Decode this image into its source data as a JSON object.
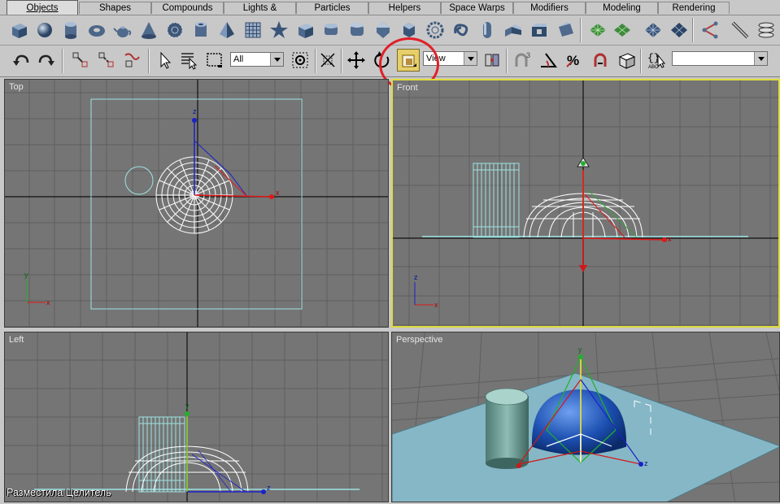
{
  "tabs": [
    {
      "label": "Objects",
      "active": true
    },
    {
      "label": "Shapes"
    },
    {
      "label": "Compounds"
    },
    {
      "label": "Lights & Cameras"
    },
    {
      "label": "Particles"
    },
    {
      "label": "Helpers"
    },
    {
      "label": "Space Warps"
    },
    {
      "label": "Modifiers"
    },
    {
      "label": "Modeling"
    },
    {
      "label": "Rendering"
    }
  ],
  "toolbar": {
    "selection_filter": "All",
    "reference_coord": "View",
    "named_selection": ""
  },
  "viewports": {
    "top": "Top",
    "front": "Front",
    "left": "Left",
    "perspective": "Perspective"
  },
  "axes": {
    "x": "x",
    "y": "y",
    "z": "z"
  },
  "caption": "Разместила Целитель",
  "colors": {
    "ui_bg": "#c8c8c8",
    "viewport_bg": "#757575",
    "active_border": "#e0dc3c",
    "highlight_circle": "#e0202a",
    "wire_white": "#ffffff",
    "wire_cyan": "#9fe3e3",
    "plane_blue": "#86b7c6"
  }
}
